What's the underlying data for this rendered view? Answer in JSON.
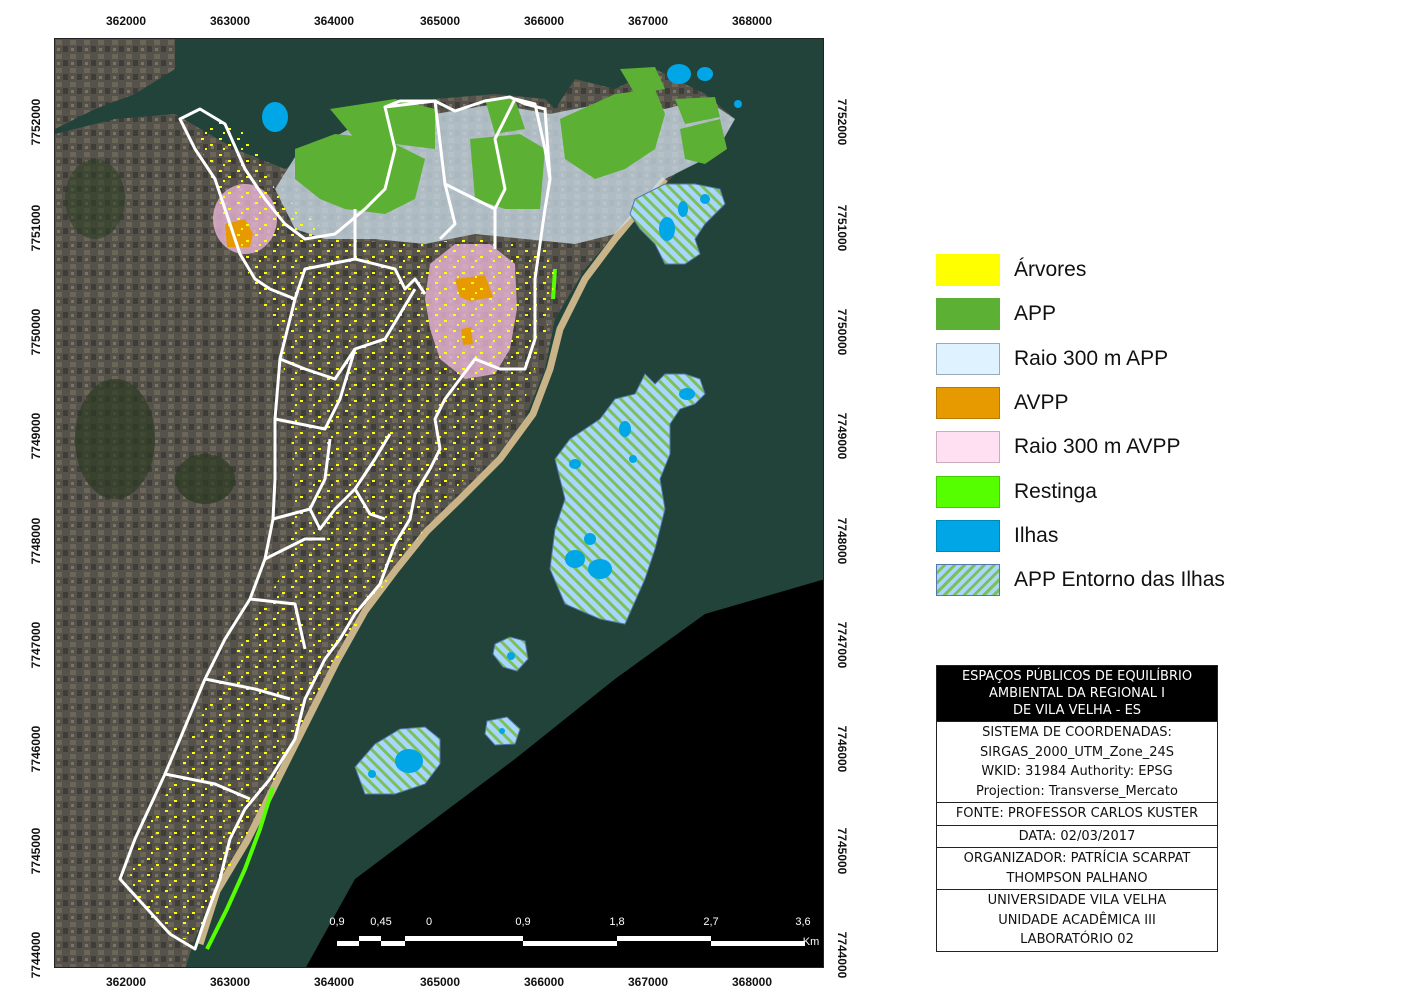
{
  "grid": {
    "eastings": [
      "362000",
      "363000",
      "364000",
      "365000",
      "366000",
      "367000",
      "368000"
    ],
    "northings": [
      "7752000",
      "7751000",
      "7750000",
      "7749000",
      "7748000",
      "7747000",
      "7746000",
      "7745000",
      "7744000"
    ]
  },
  "legend": {
    "items": [
      {
        "label": "Árvores",
        "color": "#ffff00",
        "pattern": "solid"
      },
      {
        "label": "APP",
        "color": "#5cb135",
        "pattern": "solid"
      },
      {
        "label": "Raio 300 m APP",
        "color": "#dff2ff",
        "pattern": "solid"
      },
      {
        "label": "AVPP",
        "color": "#e69a00",
        "pattern": "solid"
      },
      {
        "label": "Raio 300 m AVPP",
        "color": "#ffe0f2",
        "pattern": "solid"
      },
      {
        "label": "Restinga",
        "color": "#55ff00",
        "pattern": "solid"
      },
      {
        "label": "Ilhas",
        "color": "#00a6e6",
        "pattern": "solid"
      },
      {
        "label": "APP Entorno das Ilhas",
        "color": "#a7d7ff",
        "pattern": "hatch"
      }
    ]
  },
  "info": {
    "title": [
      "ESPAÇOS PÚBLICOS DE EQUILÍBRIO",
      "AMBIENTAL DA REGIONAL I",
      "DE VILA VELHA - ES"
    ],
    "coords": [
      "SISTEMA DE COORDENADAS:",
      "SIRGAS_2000_UTM_Zone_24S",
      "WKID: 31984 Authority: EPSG",
      "Projection: Transverse_Mercato"
    ],
    "source": "FONTE: PROFESSOR CARLOS KUSTER",
    "date": "DATA: 02/03/2017",
    "organizer": [
      "ORGANIZADOR: PATRÍCIA SCARPAT",
      "THOMPSON PALHANO"
    ],
    "institution": [
      "UNIVERSIDADE VILA VELHA",
      "UNIDADE ACADÊMICA III",
      "LABORATÓRIO 02"
    ]
  },
  "scale": {
    "labels": [
      "0,9",
      "0,45",
      "0",
      "0,9",
      "1,8",
      "2,7",
      "3,6"
    ],
    "unit": "Km"
  },
  "colors": {
    "sea": "#1f3e36",
    "land": "#4d4c45",
    "black": "#000000",
    "app": "#5cb135",
    "raio_app": "#cfe0ee",
    "avpp": "#e69a00",
    "raio_avpp": "#f4bde0",
    "restinga": "#55ff00",
    "ilhas": "#00a6e6",
    "entorno": "#a7d7ff",
    "entorno_hatch": "#7fbf5a",
    "tree": "#ffff00",
    "boundary": "#ffffff",
    "beach": "#c9b48a"
  }
}
